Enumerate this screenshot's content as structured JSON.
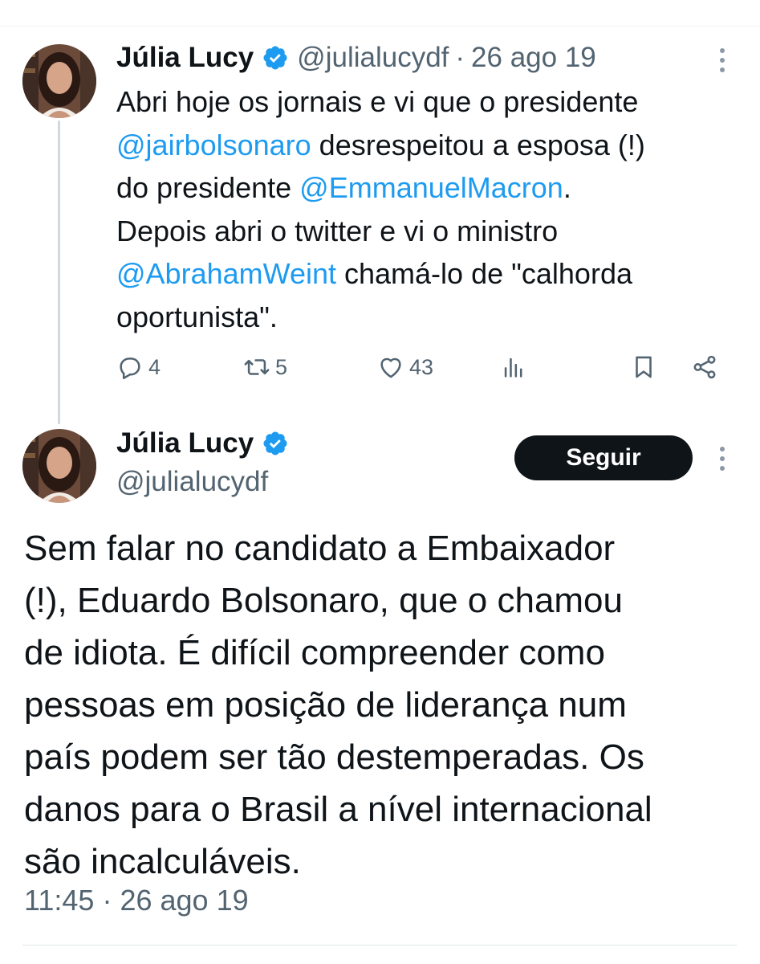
{
  "tweet1": {
    "author_name": "Júlia Lucy",
    "handle": "@julialucydf",
    "separator": "·",
    "date": "26 ago 19",
    "text_line1": "Abri hoje os jornais e vi que o presidente",
    "mention1": "@jairbolsonaro",
    "text_line2_rest": " desrespeitou a esposa (!)",
    "text_line3_start": "do presidente ",
    "mention2": "@EmmanuelMacron",
    "text_line3_end": ".",
    "text_line4": "Depois abri o twitter e vi o ministro",
    "mention3": "@AbrahamWeint",
    "text_line5_rest": " chamá-lo de \"calhorda",
    "text_line6": "oportunista\".",
    "reply_count": "4",
    "retweet_count": "5",
    "like_count": "43"
  },
  "tweet2": {
    "author_name": "Júlia Lucy",
    "handle": "@julialucydf",
    "follow_label": "Seguir",
    "lines": [
      "Sem falar no candidato a Embaixador",
      "(!), Eduardo Bolsonaro, que o chamou",
      "de idiota. É difícil compreender como",
      "pessoas em posição de liderança num",
      "país podem ser tão destemperadas. Os",
      "danos para o Brasil a nível internacional",
      "são incalculáveis."
    ],
    "time": "11:45",
    "separator": "·",
    "date": "26 ago 19"
  },
  "icons": {
    "reply": "reply-icon",
    "retweet": "retweet-icon",
    "like": "heart-icon",
    "views": "views-icon",
    "bookmark": "bookmark-icon",
    "share": "share-icon",
    "verified": "verified-badge-icon",
    "more": "more-options-icon"
  },
  "colors": {
    "link": "#1d9bf0",
    "secondary_text": "#536471",
    "follow_button_bg": "#0f1419",
    "verified_badge": "#1d9bf0"
  }
}
